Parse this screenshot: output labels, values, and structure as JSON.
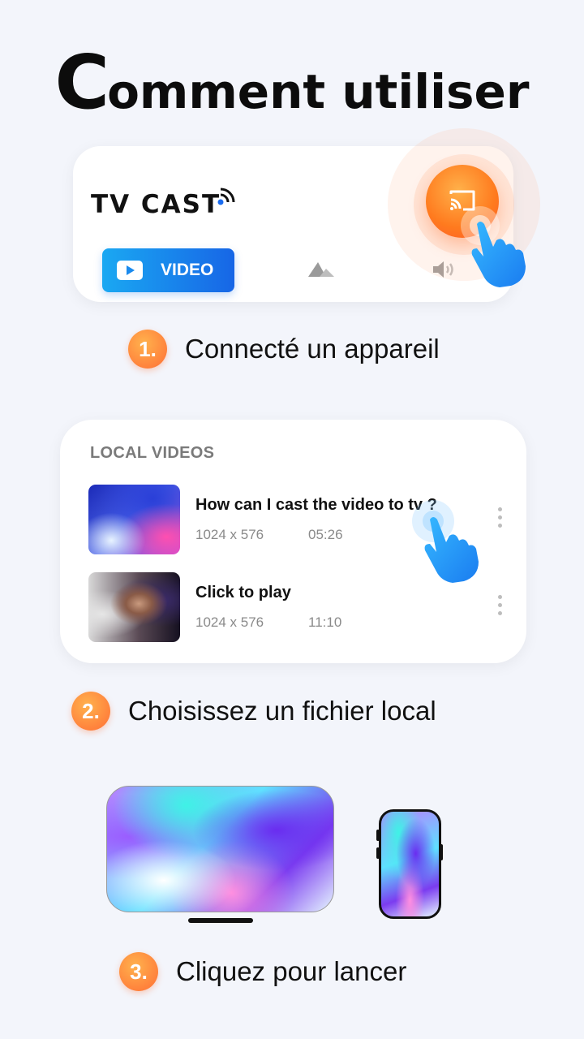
{
  "title": {
    "first_letter": "C",
    "rest": "omment utiliser"
  },
  "card1": {
    "logo": "TV CAST",
    "video_tab_label": "VIDEO",
    "icons": [
      "wifi-icon",
      "play-icon",
      "photo-icon",
      "speaker-icon",
      "cast-icon",
      "hand-pointer-icon"
    ]
  },
  "steps": [
    {
      "number": "1.",
      "text": "Connecté un appareil"
    },
    {
      "number": "2.",
      "text": "Choisissez un fichier local"
    },
    {
      "number": "3.",
      "text": "Cliquez pour lancer"
    }
  ],
  "card2": {
    "section_label": "LOCAL VIDEOS",
    "videos": [
      {
        "title": "How can I cast the video to tv ?",
        "resolution": "1024 x 576",
        "duration": "05:26"
      },
      {
        "title": "Click to play",
        "resolution": "1024 x 576",
        "duration": "11:10"
      }
    ]
  },
  "colors": {
    "accent_orange": "#ff7a1e",
    "accent_blue": "#1a8aee",
    "background": "#f3f5fb"
  }
}
